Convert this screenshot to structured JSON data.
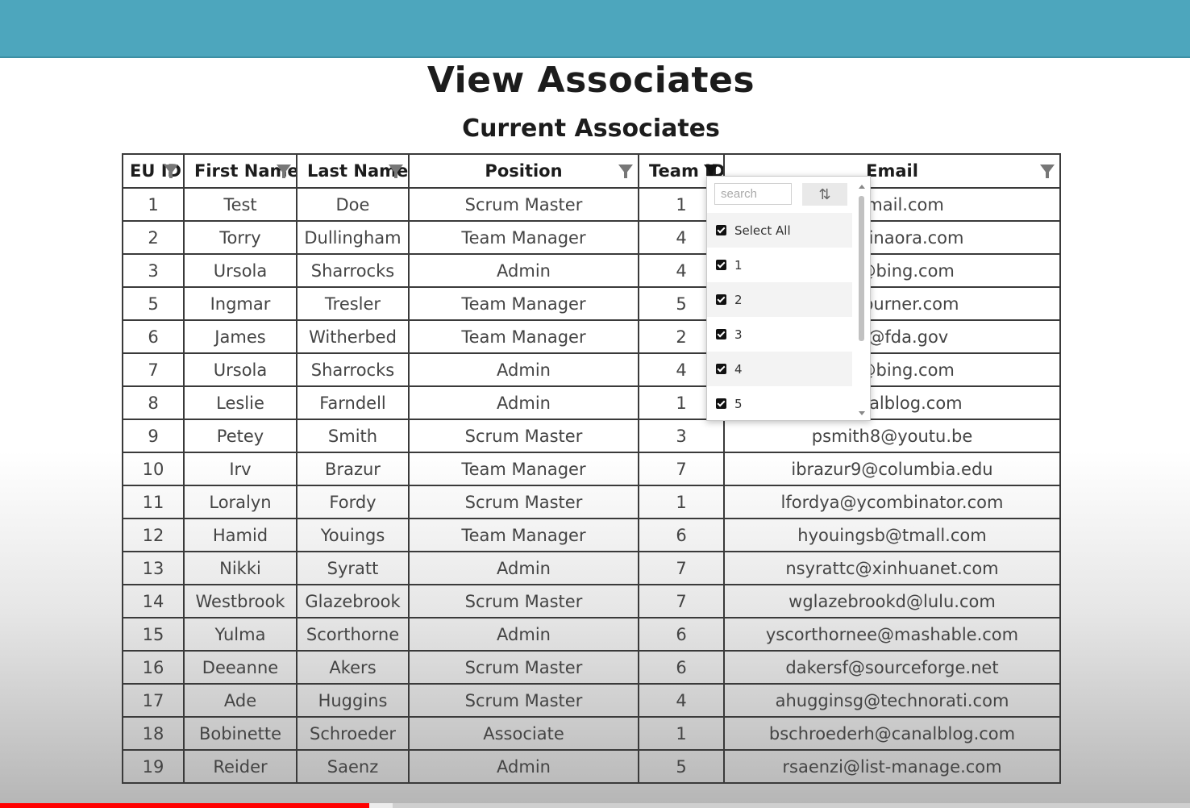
{
  "page": {
    "title": "View Associates",
    "subtitle": "Current Associates"
  },
  "table": {
    "columns": [
      "EU ID",
      "First Name",
      "Last Name",
      "Position",
      "Team ID",
      "Email"
    ],
    "rows": [
      [
        "1",
        "Test",
        "Doe",
        "Scrum Master",
        "1",
        "stemail.com"
      ],
      [
        "2",
        "Torry",
        "Dullingham",
        "Team Manager",
        "4",
        "n1@vinaora.com"
      ],
      [
        "3",
        "Ursola",
        "Sharrocks",
        "Admin",
        "4",
        "ks6@bing.com"
      ],
      [
        "5",
        "Ingmar",
        "Tresler",
        "Team Manager",
        "5",
        "feedburner.com"
      ],
      [
        "6",
        "James",
        "Witherbed",
        "Team Manager",
        "2",
        "ed5@fda.gov"
      ],
      [
        "7",
        "Ursola",
        "Sharrocks",
        "Admin",
        "4",
        "ks6@bing.com"
      ],
      [
        "8",
        "Leslie",
        "Farndell",
        "Admin",
        "1",
        "@canalblog.com"
      ],
      [
        "9",
        "Petey",
        "Smith",
        "Scrum Master",
        "3",
        "psmith8@youtu.be"
      ],
      [
        "10",
        "Irv",
        "Brazur",
        "Team Manager",
        "7",
        "ibrazur9@columbia.edu"
      ],
      [
        "11",
        "Loralyn",
        "Fordy",
        "Scrum Master",
        "1",
        "lfordya@ycombinator.com"
      ],
      [
        "12",
        "Hamid",
        "Youings",
        "Team Manager",
        "6",
        "hyouingsb@tmall.com"
      ],
      [
        "13",
        "Nikki",
        "Syratt",
        "Admin",
        "7",
        "nsyrattc@xinhuanet.com"
      ],
      [
        "14",
        "Westbrook",
        "Glazebrook",
        "Scrum Master",
        "7",
        "wglazebrookd@lulu.com"
      ],
      [
        "15",
        "Yulma",
        "Scorthorne",
        "Admin",
        "6",
        "yscorthornee@mashable.com"
      ],
      [
        "16",
        "Deeanne",
        "Akers",
        "Scrum Master",
        "6",
        "dakersf@sourceforge.net"
      ],
      [
        "17",
        "Ade",
        "Huggins",
        "Scrum Master",
        "4",
        "ahugginsg@technorati.com"
      ],
      [
        "18",
        "Bobinette",
        "Schroeder",
        "Associate",
        "1",
        "bschroederh@canalblog.com"
      ],
      [
        "19",
        "Reider",
        "Saenz",
        "Admin",
        "5",
        "rsaenzi@list-manage.com"
      ]
    ]
  },
  "filter_dropdown": {
    "search_placeholder": "search",
    "sort_icon": "sort-arrows-icon",
    "items": [
      {
        "label": "Select All",
        "checked": true
      },
      {
        "label": "1",
        "checked": true
      },
      {
        "label": "2",
        "checked": true
      },
      {
        "label": "3",
        "checked": true
      },
      {
        "label": "4",
        "checked": true
      },
      {
        "label": "5",
        "checked": true
      }
    ]
  },
  "video_progress": {
    "played_fraction": 0.31,
    "buffered_fraction": 0.33
  },
  "colors": {
    "header_bar": "#4da6bd",
    "progress": "#ff0000"
  }
}
